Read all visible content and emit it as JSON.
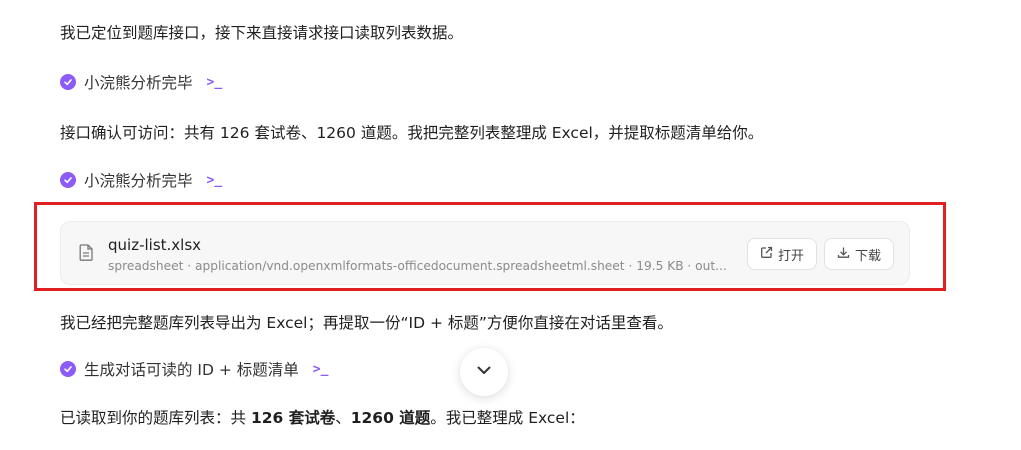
{
  "messages": {
    "line1": "我已定位到题库接口，接下来直接请求接口读取列表数据。",
    "step1": "小浣熊分析完毕",
    "line2": "接口确认可访问：共有 126 套试卷、1260 道题。我把完整列表整理成 Excel，并提取标题清单给你。",
    "step2": "小浣熊分析完毕",
    "line3": "我已经把完整题库列表导出为 Excel；再提取一份“ID + 标题”方便你直接在对话里查看。",
    "step3": "生成对话可读的 ID + 标题清单",
    "line4": {
      "prefix": "已读取到你的题库列表：共 ",
      "bold1": "126 套试卷",
      "sep": "、",
      "bold2": "1260 道题",
      "suffix": "。我已整理成 Excel："
    }
  },
  "step_icon": "check-circle-icon",
  "term_icon": "terminal-icon",
  "file": {
    "name": "quiz-list.xlsx",
    "meta": "spreadsheet · application/vnd.openxmlformats-officedocument.spreadsheetml.sheet · 19.5 KB · out...",
    "open_label": "打开",
    "download_label": "下载"
  },
  "colors": {
    "accent": "#8b5cf6",
    "highlight": "#e02020"
  }
}
